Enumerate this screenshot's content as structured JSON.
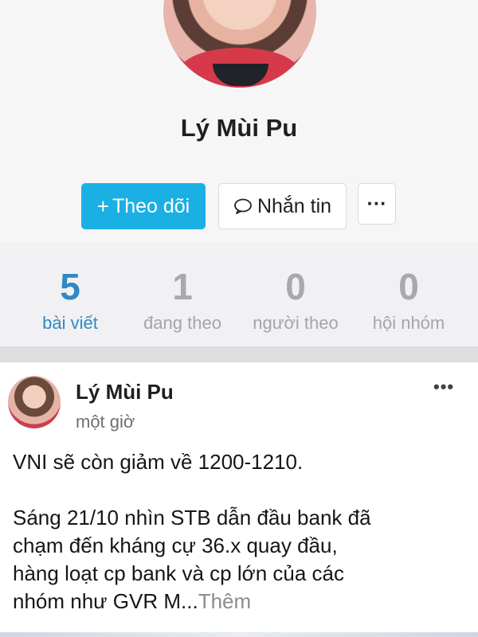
{
  "profile": {
    "name": "Lý Mùi Pu",
    "avatar_icon": "profile-photo"
  },
  "actions": {
    "follow_label": "Theo dõi",
    "follow_icon": "plus-icon",
    "message_label": "Nhắn tin",
    "message_icon": "chat-bubble-icon",
    "more_label": "···",
    "accent_color": "#1ab0e4"
  },
  "stats": [
    {
      "value": "5",
      "label": "bài viết",
      "active": true
    },
    {
      "value": "1",
      "label": "đang theo",
      "active": false
    },
    {
      "value": "0",
      "label": "người theo",
      "active": false
    },
    {
      "value": "0",
      "label": "hội nhóm",
      "active": false
    }
  ],
  "post": {
    "author": "Lý Mùi Pu",
    "time": "một giờ",
    "menu_label": "•••",
    "line1": "VNI sẽ còn giảm về 1200-1210.",
    "line2": "Sáng 21/10 nhìn STB dẫn đầu bank đã",
    "line3": "chạm đến kháng cự 36.x quay đầu,",
    "line4": "hàng loạt cp bank và cp lớn của các",
    "line5": "nhóm như GVR M...",
    "more_link": "Thêm"
  }
}
